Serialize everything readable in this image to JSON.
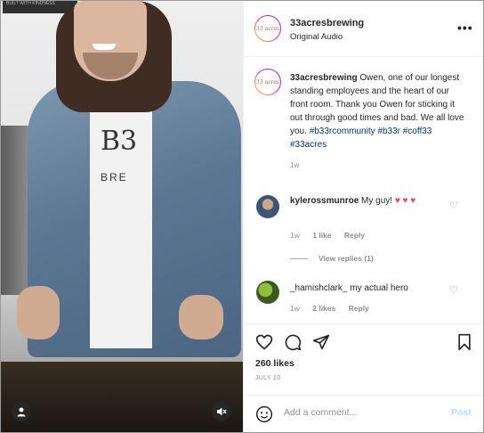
{
  "media": {
    "shirt_text": "B3",
    "shirt_text2": "BRE",
    "sign_text": "BUILT WITH KINDNESS"
  },
  "header": {
    "username": "33acresbrewing",
    "subtitle": "Original Audio",
    "more": "•••",
    "avatar_text": "33 acres"
  },
  "caption": {
    "username": "33acresbrewing",
    "text": "Owen, one of our longest standing employees and the heart of our front room. Thank you Owen for sticking it out through good times and bad. We all love you.",
    "hashtags": "#b33rcommunity #b33r #coff33 #33acres",
    "time": "1w"
  },
  "comments": [
    {
      "username": "kylerossmunroe",
      "text": "My guy!",
      "emoji": "♥ ♥ ♥",
      "time": "1w",
      "likes": "1 like",
      "reply": "Reply"
    },
    {
      "username": "_hamishclark_",
      "text": "my actual hero",
      "time": "1w",
      "likes": "2 likes",
      "reply": "Reply"
    }
  ],
  "view_replies": "View replies (1)",
  "likes": "260 likes",
  "date": "JULY 10",
  "add_comment_placeholder": "Add a comment...",
  "post_label": "Post",
  "colors": {
    "accent_blue": "#0095f6",
    "heart": "#ed4956",
    "hashtag": "#00376b"
  }
}
